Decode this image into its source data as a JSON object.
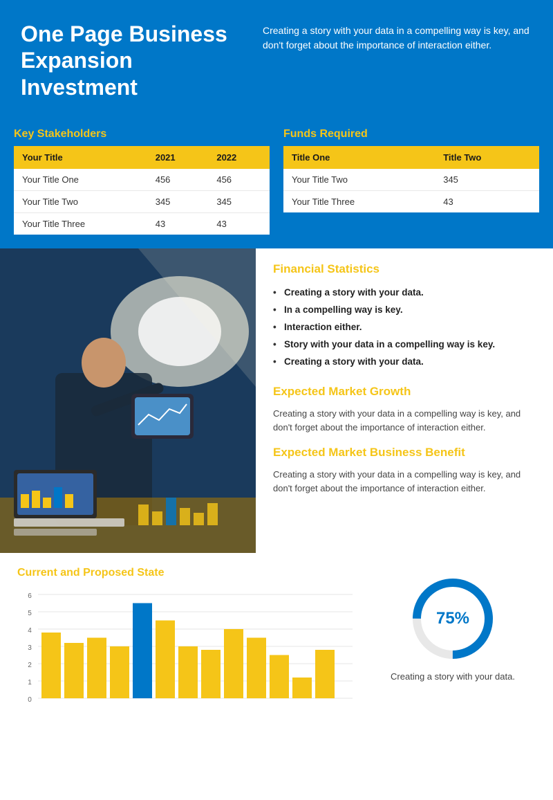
{
  "header": {
    "title": "One Page Business Expansion Investment",
    "description": "Creating a story with your data in a compelling way is key, and don't forget about the importance of interaction either."
  },
  "stakeholders": {
    "section_title": "Key Stakeholders",
    "columns": [
      "Your Title",
      "2021",
      "2022"
    ],
    "rows": [
      [
        "Your Title One",
        "456",
        "456"
      ],
      [
        "Your Title Two",
        "345",
        "345"
      ],
      [
        "Your Title Three",
        "43",
        "43"
      ]
    ]
  },
  "funds": {
    "section_title": "Funds Required",
    "columns": [
      "Title One",
      "Title Two"
    ],
    "rows": [
      [
        "Your Title Two",
        "345"
      ],
      [
        "Your Title Three",
        "43"
      ]
    ]
  },
  "financial_statistics": {
    "heading": "Financial Statistics",
    "bullets": [
      "Creating a story with your data.",
      "In a compelling way is key.",
      "Interaction either.",
      "Story with your data in a compelling way is key.",
      "Creating a story with your data."
    ]
  },
  "expected_market_growth": {
    "heading": "Expected Market Growth",
    "text": "Creating a story with your data in a compelling way is key, and don't forget about the importance of interaction either."
  },
  "expected_market_benefit": {
    "heading": "Expected Market Business Benefit",
    "text": "Creating a story with your data in a compelling way is key, and don't forget about the importance of interaction either."
  },
  "chart": {
    "title": "Current and Proposed State",
    "y_labels": [
      "0",
      "1",
      "2",
      "3",
      "4",
      "5",
      "6"
    ],
    "bars": [
      {
        "value": 3.8,
        "color": "#f5c518"
      },
      {
        "value": 3.2,
        "color": "#f5c518"
      },
      {
        "value": 3.5,
        "color": "#f5c518"
      },
      {
        "value": 3.0,
        "color": "#f5c518"
      },
      {
        "value": 5.5,
        "color": "#0077c8"
      },
      {
        "value": 4.5,
        "color": "#f5c518"
      },
      {
        "value": 3.0,
        "color": "#f5c518"
      },
      {
        "value": 2.8,
        "color": "#f5c518"
      },
      {
        "value": 4.0,
        "color": "#f5c518"
      },
      {
        "value": 3.5,
        "color": "#f5c518"
      },
      {
        "value": 2.5,
        "color": "#f5c518"
      },
      {
        "value": 1.2,
        "color": "#f5c518"
      },
      {
        "value": 2.8,
        "color": "#f5c518"
      }
    ]
  },
  "donut": {
    "percent": "75%",
    "caption": "Creating a story with your data.",
    "filled_color": "#0077c8",
    "empty_color": "#e8e8e8",
    "value": 75
  }
}
